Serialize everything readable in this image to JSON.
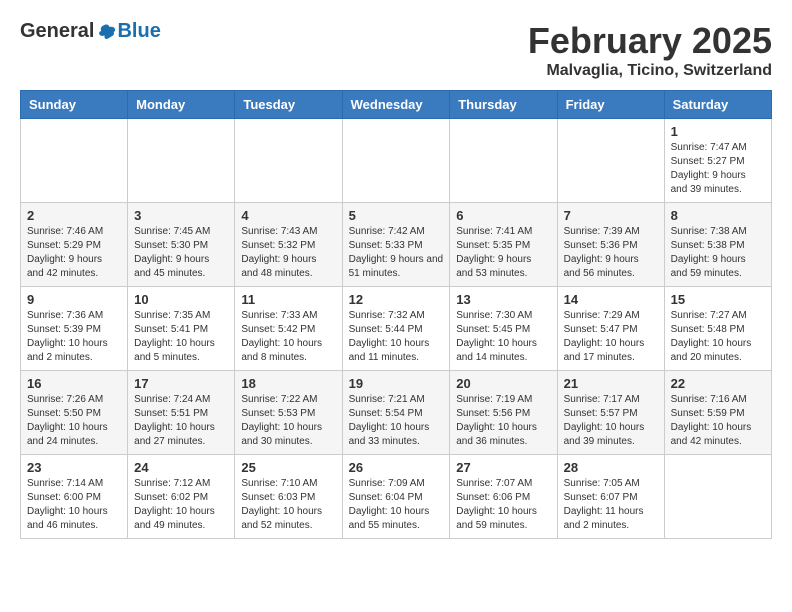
{
  "header": {
    "logo_general": "General",
    "logo_blue": "Blue",
    "month_title": "February 2025",
    "location": "Malvaglia, Ticino, Switzerland"
  },
  "weekdays": [
    "Sunday",
    "Monday",
    "Tuesday",
    "Wednesday",
    "Thursday",
    "Friday",
    "Saturday"
  ],
  "weeks": [
    [
      {
        "day": "",
        "empty": true
      },
      {
        "day": "",
        "empty": true
      },
      {
        "day": "",
        "empty": true
      },
      {
        "day": "",
        "empty": true
      },
      {
        "day": "",
        "empty": true
      },
      {
        "day": "",
        "empty": true
      },
      {
        "day": "1",
        "sunrise": "Sunrise: 7:47 AM",
        "sunset": "Sunset: 5:27 PM",
        "daylight": "Daylight: 9 hours and 39 minutes."
      }
    ],
    [
      {
        "day": "2",
        "sunrise": "Sunrise: 7:46 AM",
        "sunset": "Sunset: 5:29 PM",
        "daylight": "Daylight: 9 hours and 42 minutes."
      },
      {
        "day": "3",
        "sunrise": "Sunrise: 7:45 AM",
        "sunset": "Sunset: 5:30 PM",
        "daylight": "Daylight: 9 hours and 45 minutes."
      },
      {
        "day": "4",
        "sunrise": "Sunrise: 7:43 AM",
        "sunset": "Sunset: 5:32 PM",
        "daylight": "Daylight: 9 hours and 48 minutes."
      },
      {
        "day": "5",
        "sunrise": "Sunrise: 7:42 AM",
        "sunset": "Sunset: 5:33 PM",
        "daylight": "Daylight: 9 hours and 51 minutes."
      },
      {
        "day": "6",
        "sunrise": "Sunrise: 7:41 AM",
        "sunset": "Sunset: 5:35 PM",
        "daylight": "Daylight: 9 hours and 53 minutes."
      },
      {
        "day": "7",
        "sunrise": "Sunrise: 7:39 AM",
        "sunset": "Sunset: 5:36 PM",
        "daylight": "Daylight: 9 hours and 56 minutes."
      },
      {
        "day": "8",
        "sunrise": "Sunrise: 7:38 AM",
        "sunset": "Sunset: 5:38 PM",
        "daylight": "Daylight: 9 hours and 59 minutes."
      }
    ],
    [
      {
        "day": "9",
        "sunrise": "Sunrise: 7:36 AM",
        "sunset": "Sunset: 5:39 PM",
        "daylight": "Daylight: 10 hours and 2 minutes."
      },
      {
        "day": "10",
        "sunrise": "Sunrise: 7:35 AM",
        "sunset": "Sunset: 5:41 PM",
        "daylight": "Daylight: 10 hours and 5 minutes."
      },
      {
        "day": "11",
        "sunrise": "Sunrise: 7:33 AM",
        "sunset": "Sunset: 5:42 PM",
        "daylight": "Daylight: 10 hours and 8 minutes."
      },
      {
        "day": "12",
        "sunrise": "Sunrise: 7:32 AM",
        "sunset": "Sunset: 5:44 PM",
        "daylight": "Daylight: 10 hours and 11 minutes."
      },
      {
        "day": "13",
        "sunrise": "Sunrise: 7:30 AM",
        "sunset": "Sunset: 5:45 PM",
        "daylight": "Daylight: 10 hours and 14 minutes."
      },
      {
        "day": "14",
        "sunrise": "Sunrise: 7:29 AM",
        "sunset": "Sunset: 5:47 PM",
        "daylight": "Daylight: 10 hours and 17 minutes."
      },
      {
        "day": "15",
        "sunrise": "Sunrise: 7:27 AM",
        "sunset": "Sunset: 5:48 PM",
        "daylight": "Daylight: 10 hours and 20 minutes."
      }
    ],
    [
      {
        "day": "16",
        "sunrise": "Sunrise: 7:26 AM",
        "sunset": "Sunset: 5:50 PM",
        "daylight": "Daylight: 10 hours and 24 minutes."
      },
      {
        "day": "17",
        "sunrise": "Sunrise: 7:24 AM",
        "sunset": "Sunset: 5:51 PM",
        "daylight": "Daylight: 10 hours and 27 minutes."
      },
      {
        "day": "18",
        "sunrise": "Sunrise: 7:22 AM",
        "sunset": "Sunset: 5:53 PM",
        "daylight": "Daylight: 10 hours and 30 minutes."
      },
      {
        "day": "19",
        "sunrise": "Sunrise: 7:21 AM",
        "sunset": "Sunset: 5:54 PM",
        "daylight": "Daylight: 10 hours and 33 minutes."
      },
      {
        "day": "20",
        "sunrise": "Sunrise: 7:19 AM",
        "sunset": "Sunset: 5:56 PM",
        "daylight": "Daylight: 10 hours and 36 minutes."
      },
      {
        "day": "21",
        "sunrise": "Sunrise: 7:17 AM",
        "sunset": "Sunset: 5:57 PM",
        "daylight": "Daylight: 10 hours and 39 minutes."
      },
      {
        "day": "22",
        "sunrise": "Sunrise: 7:16 AM",
        "sunset": "Sunset: 5:59 PM",
        "daylight": "Daylight: 10 hours and 42 minutes."
      }
    ],
    [
      {
        "day": "23",
        "sunrise": "Sunrise: 7:14 AM",
        "sunset": "Sunset: 6:00 PM",
        "daylight": "Daylight: 10 hours and 46 minutes."
      },
      {
        "day": "24",
        "sunrise": "Sunrise: 7:12 AM",
        "sunset": "Sunset: 6:02 PM",
        "daylight": "Daylight: 10 hours and 49 minutes."
      },
      {
        "day": "25",
        "sunrise": "Sunrise: 7:10 AM",
        "sunset": "Sunset: 6:03 PM",
        "daylight": "Daylight: 10 hours and 52 minutes."
      },
      {
        "day": "26",
        "sunrise": "Sunrise: 7:09 AM",
        "sunset": "Sunset: 6:04 PM",
        "daylight": "Daylight: 10 hours and 55 minutes."
      },
      {
        "day": "27",
        "sunrise": "Sunrise: 7:07 AM",
        "sunset": "Sunset: 6:06 PM",
        "daylight": "Daylight: 10 hours and 59 minutes."
      },
      {
        "day": "28",
        "sunrise": "Sunrise: 7:05 AM",
        "sunset": "Sunset: 6:07 PM",
        "daylight": "Daylight: 11 hours and 2 minutes."
      },
      {
        "day": "",
        "empty": true
      }
    ]
  ]
}
